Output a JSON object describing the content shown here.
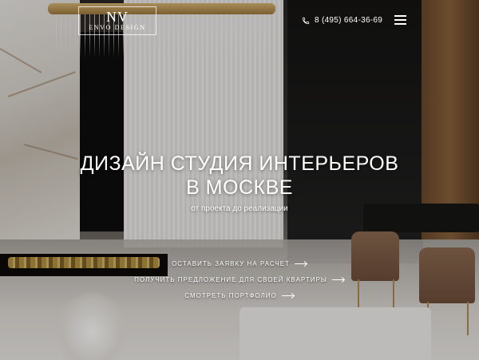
{
  "header": {
    "logo_mark": "NV",
    "logo_sub": "ENVO DESIGN",
    "phone": "8 (495) 664-36-69",
    "phone_icon": "phone-icon",
    "menu_icon": "menu-icon"
  },
  "hero": {
    "title_line1": "ДИЗАЙН СТУДИЯ ИНТЕРЬЕРОВ",
    "title_line2": "В МОСКВЕ",
    "subtitle": "от проекта до реализации"
  },
  "links": [
    {
      "label": "ОСТАВИТЬ ЗАЯВКУ НА РАСЧЕТ"
    },
    {
      "label": "ПОЛУЧИТЬ ПРЕДЛОЖЕНИЕ ДЛЯ СВОЕЙ КВАРТИРЫ"
    },
    {
      "label": "СМОТРЕТЬ ПОРТФОЛИО"
    }
  ],
  "colors": {
    "text": "#ffffff",
    "gold": "#c8a248"
  }
}
